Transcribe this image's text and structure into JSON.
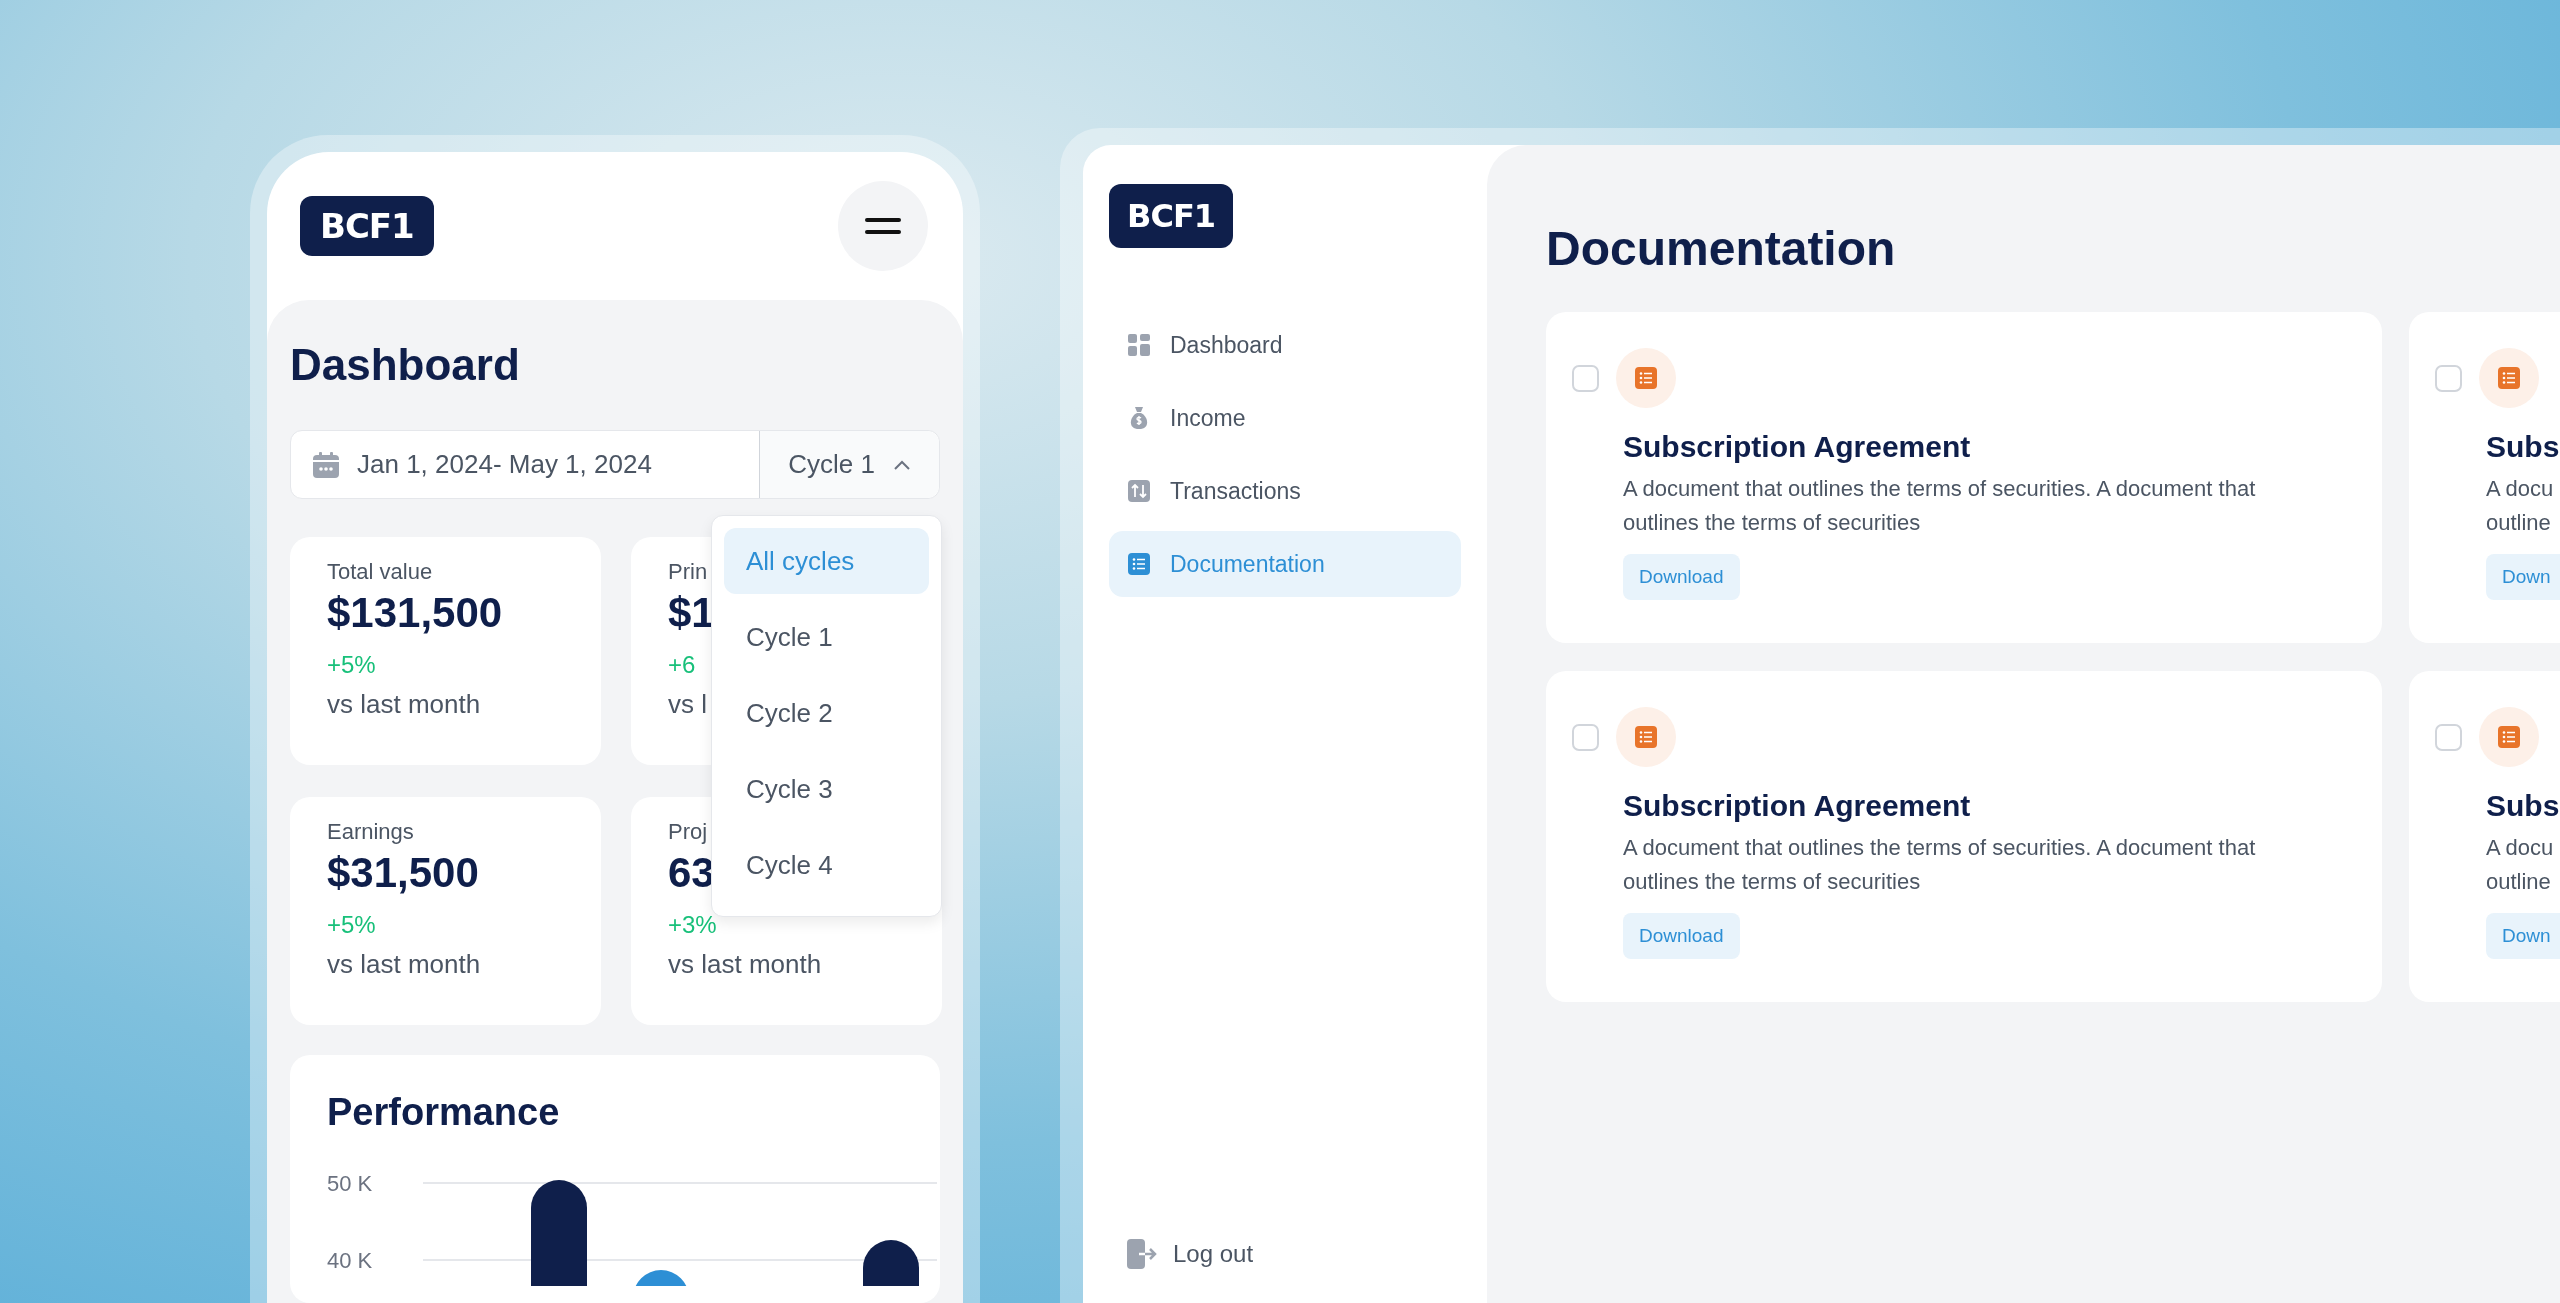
{
  "mobile": {
    "logo": "BCF1",
    "title": "Dashboard",
    "date_range": "Jan 1, 2024- May 1, 2024",
    "cycle_select": {
      "value": "Cycle 1",
      "expanded": true
    },
    "cycle_options": [
      {
        "label": "All cycles",
        "selected": true
      },
      {
        "label": "Cycle 1",
        "selected": false
      },
      {
        "label": "Cycle 2",
        "selected": false
      },
      {
        "label": "Cycle 3",
        "selected": false
      },
      {
        "label": "Cycle 4",
        "selected": false
      }
    ],
    "stats": [
      {
        "label": "Total value",
        "value": "$131,500",
        "change": "+5%",
        "note": "vs last month"
      },
      {
        "label": "Prin",
        "value": "$1",
        "change": "+6",
        "note": "vs l"
      },
      {
        "label": "Earnings",
        "value": "$31,500",
        "change": "+5%",
        "note": "vs last month"
      },
      {
        "label": "Proj",
        "value": "63",
        "change": "+3%",
        "note": "vs last month"
      }
    ],
    "performance": {
      "title": "Performance",
      "axis_labels": [
        "50 K",
        "40 K"
      ]
    }
  },
  "desktop": {
    "logo": "BCF1",
    "nav": [
      {
        "label": "Dashboard",
        "kind": "grid",
        "selected": false
      },
      {
        "label": "Income",
        "kind": "moneybag",
        "selected": false
      },
      {
        "label": "Transactions",
        "kind": "arrows",
        "selected": false
      },
      {
        "label": "Documentation",
        "kind": "list",
        "selected": true
      }
    ],
    "logout": "Log out",
    "title": "Documentation",
    "documents": [
      {
        "title": "Subscription Agreement",
        "description": "A document that outlines the terms of securities. A document that outlines the terms of securities",
        "button": "Download",
        "checked": false
      },
      {
        "title": "Subs",
        "description": "A docu outline",
        "button": "Down",
        "checked": false
      },
      {
        "title": "Subscription Agreement",
        "description": "A document that outlines the terms of securities. A document that outlines the terms of securities",
        "button": "Download",
        "checked": false
      },
      {
        "title": "Subs",
        "description": "A docu outline",
        "button": "Down",
        "checked": false
      }
    ]
  }
}
